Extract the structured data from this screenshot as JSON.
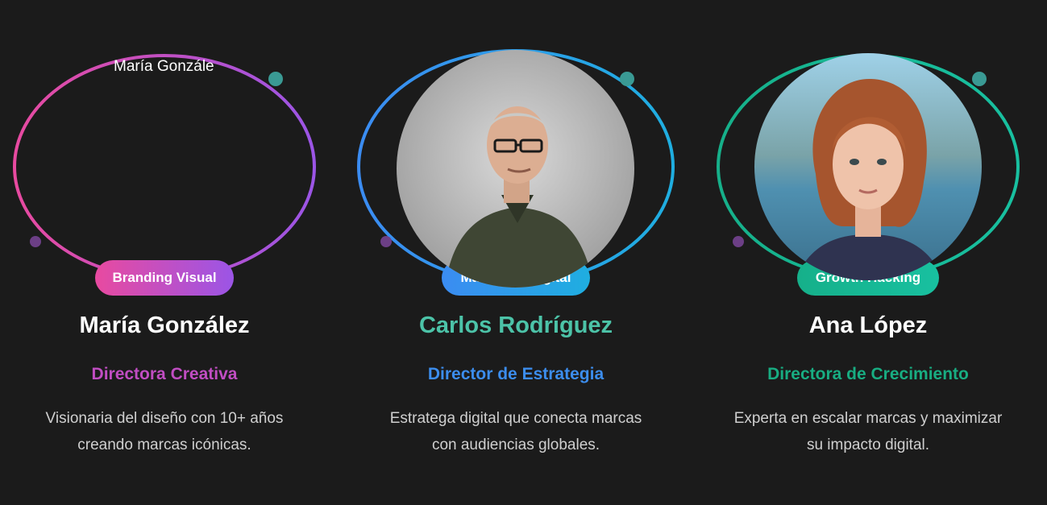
{
  "team": [
    {
      "image_alt": "María Gonzále",
      "badge": "Branding Visual",
      "name": "María González",
      "role": "Directora Creativa",
      "bio_line1": "Visionaria del diseño con 10+ años",
      "bio_line2": "creando marcas icónicas.",
      "colors": {
        "ring_start": "#e84aa0",
        "ring_end": "#9b55e6",
        "dot_top": "#3a9a94",
        "dot_bottom": "#6c3f86"
      }
    },
    {
      "badge": "Marketing Digital",
      "name": "Carlos Rodríguez",
      "role": "Director de Estrategia",
      "bio_line1": "Estratega digital que conecta marcas",
      "bio_line2": "con audiencias globales.",
      "colors": {
        "ring_start": "#3b8cf2",
        "ring_end": "#1faee0",
        "dot_top": "#3a9a94",
        "dot_bottom": "#6c3f86"
      }
    },
    {
      "badge": "Growth Hacking",
      "name": "Ana López",
      "role": "Directora de Crecimiento",
      "bio_line1": "Experta en escalar marcas y maximizar",
      "bio_line2": "su impacto digital.",
      "colors": {
        "ring_start": "#16b08a",
        "ring_end": "#18c0a0",
        "dot_top": "#3a9a94",
        "dot_bottom": "#6c3f86"
      }
    }
  ]
}
